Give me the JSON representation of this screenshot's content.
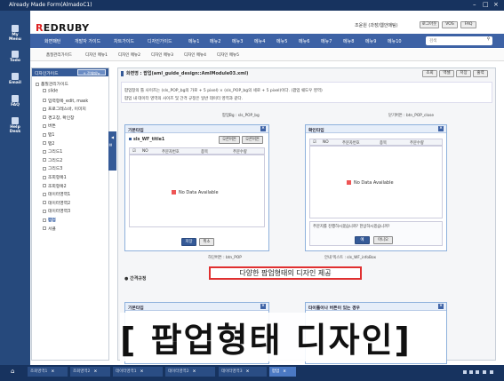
{
  "window": {
    "title": "Already Made Form(AlmadoC1)"
  },
  "leftbar": {
    "items": [
      {
        "label": "My\nMenu"
      },
      {
        "label": "Todo"
      },
      {
        "label": "Email"
      },
      {
        "label": "FAQ"
      },
      {
        "label": "Help\nDesk"
      }
    ]
  },
  "header": {
    "logo_r": "R",
    "logo_rest": "EDRUBY",
    "user": "조윤원 (과장/웹안매팀)",
    "btn_logout": "로그아웃",
    "btn_vos": "VOS",
    "btn_faq": "FAQ"
  },
  "mainnav": {
    "items": [
      "화면패턴",
      "개발자 가이드",
      "차트가이드",
      "디자인가이드",
      "메뉴1",
      "메뉴2",
      "메뉴3",
      "메뉴4",
      "메뉴5",
      "메뉴6",
      "메뉴7",
      "메뉴8",
      "메뉴9",
      "메뉴10"
    ],
    "search_placeholder": "검색"
  },
  "subnav": {
    "items": [
      "품질관리가이드",
      "디자인 메뉴1",
      "디자인 메뉴2",
      "디자인 메뉴3",
      "디자인 메뉴4",
      "디자인 메뉴5"
    ]
  },
  "sidebar": {
    "head": "디자인가이드",
    "add_btn": "+ 전체메뉴",
    "root": "품질관리가이드",
    "items": [
      "slide",
      "입력항목_edit, mask",
      "프로그레스바, 이미지",
      "경고창, 확인창",
      "버튼",
      "탭1",
      "탭2",
      "그리드1",
      "그리드2",
      "그리드3",
      "조회항목1",
      "조회항목2",
      "데이터영역1",
      "데이터영역2",
      "데이터영역3",
      "팝업",
      "서클"
    ]
  },
  "content": {
    "title": "화면명 : 팝업(aml_guide_design::AmlModule03.xml)",
    "btns": [
      "조회",
      "엑셀",
      "저장",
      "출력"
    ],
    "desc1": "팝업창의 틀 사이즈는 (sls_POP_bg의 가로 + 5 pixel) × (sls_POP_bg의 세로 + 5 pixel)이다. (팝업 쉐도우 영역)",
    "desc2": "팝업 내 데이터 영역의 사이즈 및 간격 규정은 일반 데이터 영역과 같다.",
    "label_bg": "팝업Bg : sls_POP_bg",
    "label_close": "닫기버튼 : btn_POP_close",
    "label_bottom": "하단버튼 : btn_POP",
    "label_msg": "안내 텍스트 : sls_WF_infoBox",
    "callout": "다양한 팝업형태의 디자인 제공",
    "section2": "● 간격규정",
    "big_title": "[ 팝업형태 디자인]"
  },
  "panel1": {
    "title": "기본타입",
    "subtitle": "sls_WF_title1",
    "btn_a": "오른버튼",
    "btn_b": "오른버튼",
    "cols": [
      "NO",
      "주문자번호",
      "종목",
      "주문수량"
    ],
    "nodata": "No Data Available",
    "save": "저장",
    "cancel": "취소"
  },
  "panel2": {
    "title": "확인타입",
    "cols": [
      "NO",
      "주문자번호",
      "종목",
      "주문수량"
    ],
    "nodata": "No Data Available",
    "msg": "주문지를 진행하시겠습니까? 한상하시겠습니까?",
    "yes": "예",
    "no": "아니오"
  },
  "panel3": {
    "title": "기본타입"
  },
  "panel4": {
    "title": "타이틀이나 버튼이 있는 경우"
  },
  "taskbar": {
    "tabs": [
      {
        "label": "조회영역1",
        "active": false
      },
      {
        "label": "조회영역2",
        "active": false
      },
      {
        "label": "데이터영역1",
        "active": false
      },
      {
        "label": "데이터영역2",
        "active": false
      },
      {
        "label": "데이터영역3",
        "active": false
      },
      {
        "label": "팝업",
        "active": true
      }
    ]
  }
}
